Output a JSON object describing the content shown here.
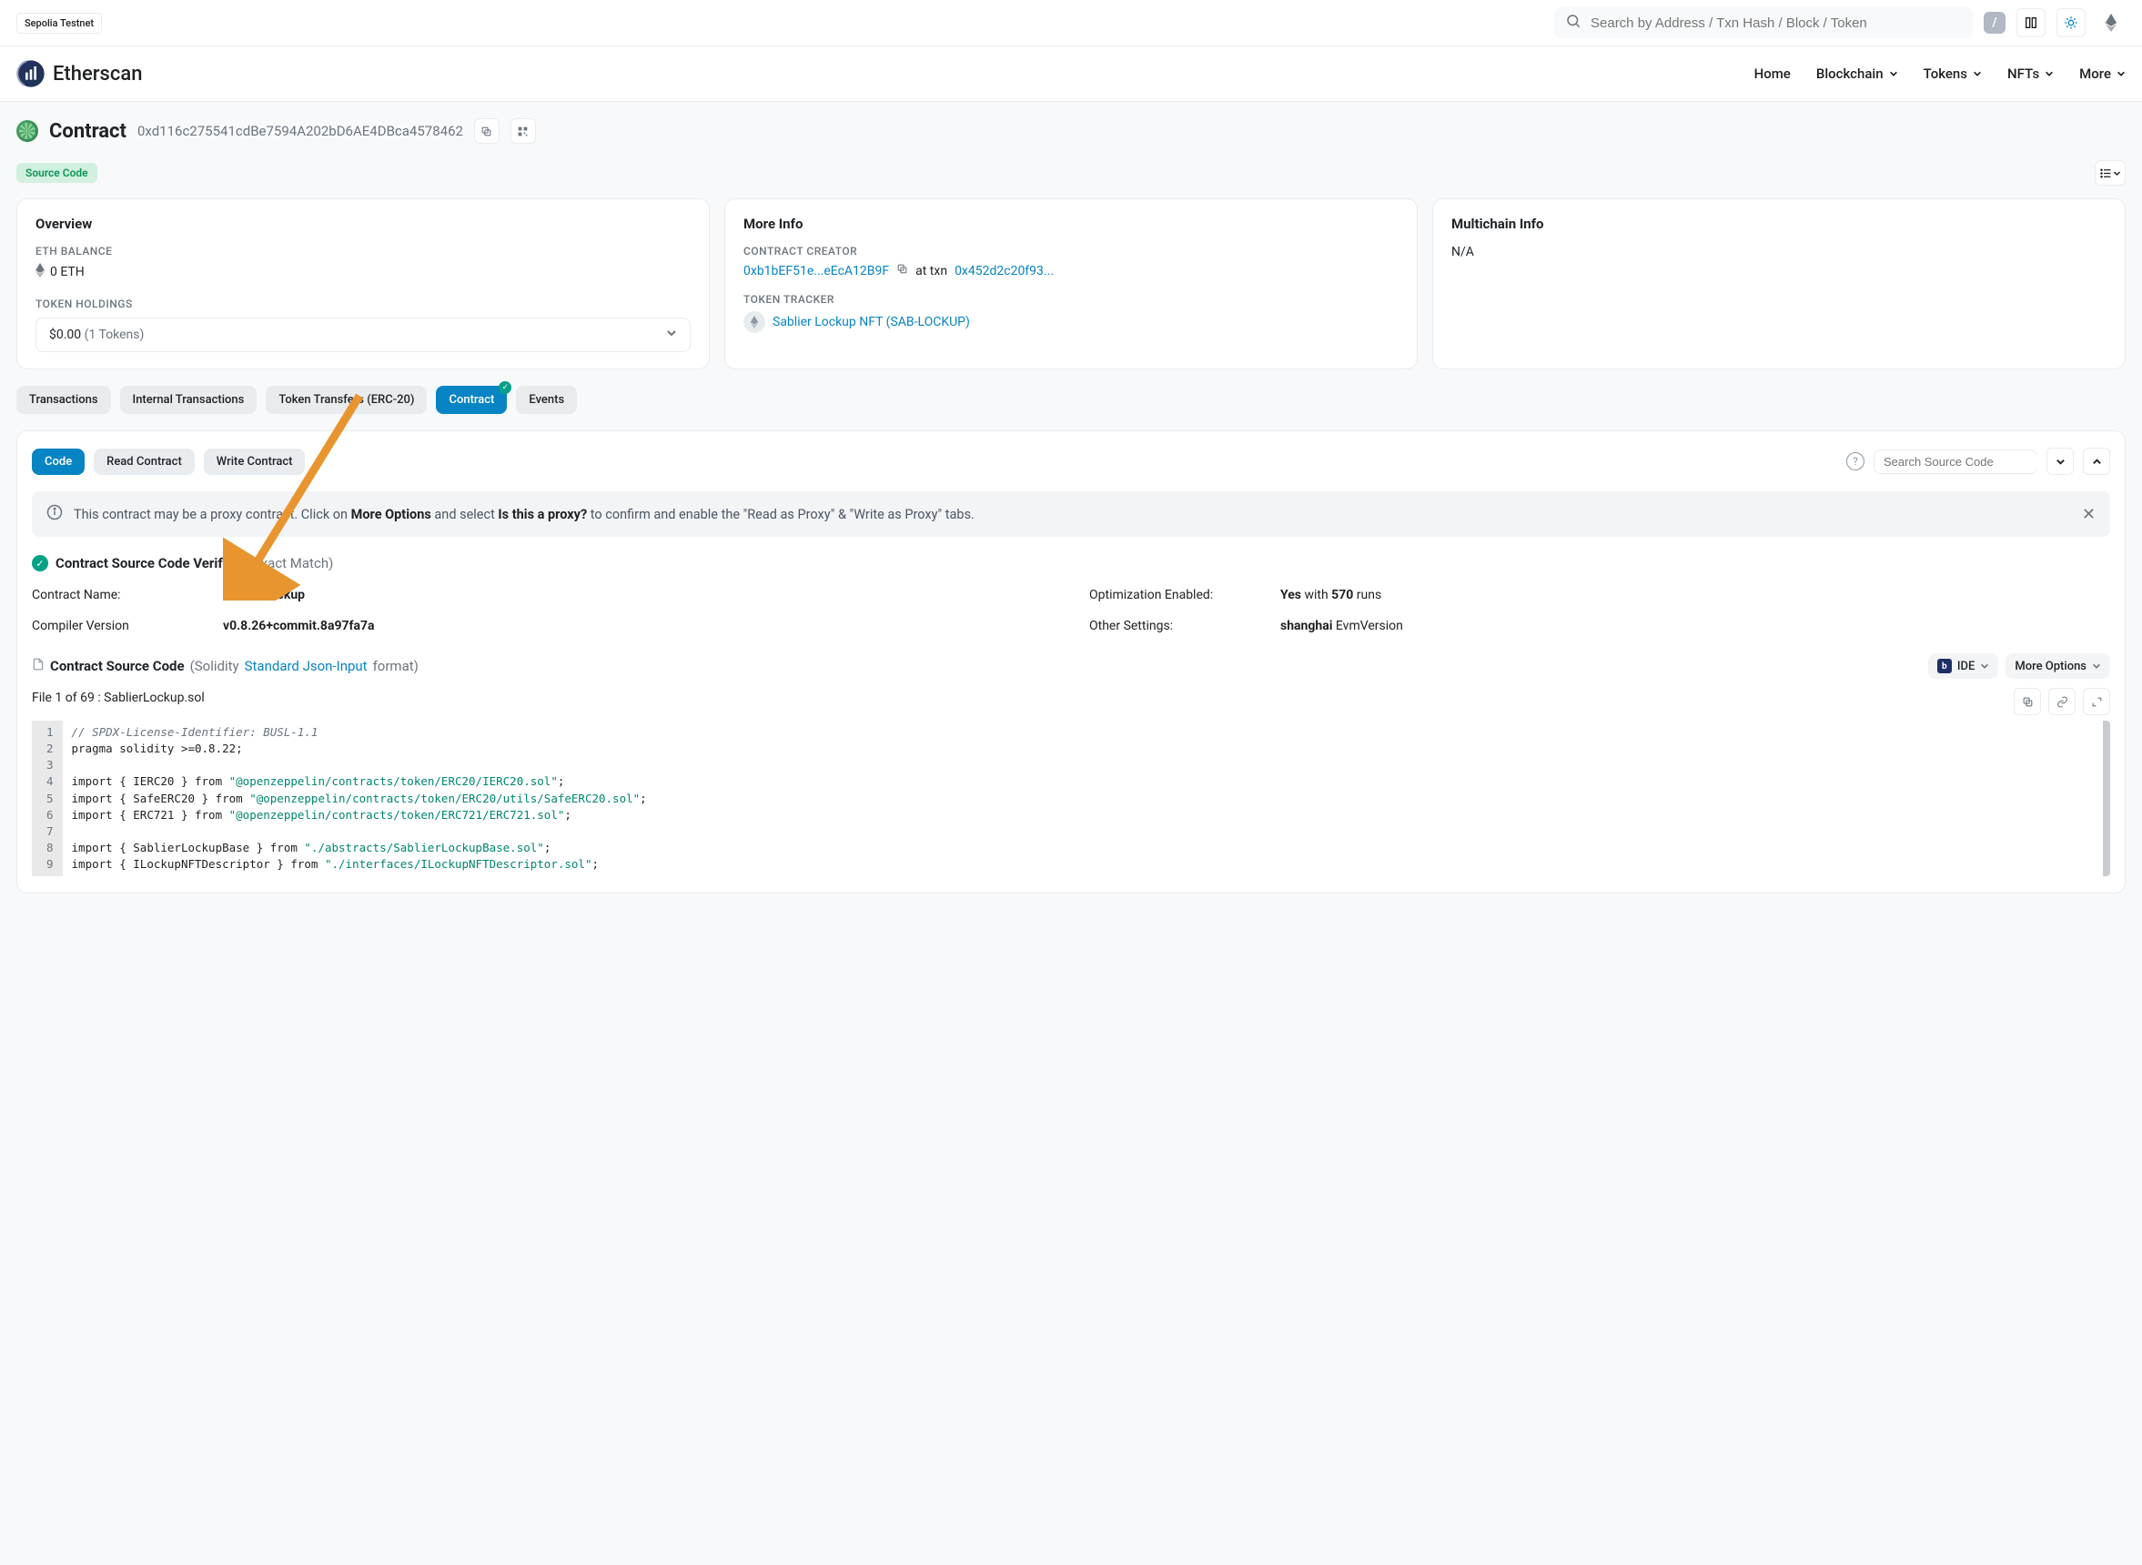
{
  "topbar": {
    "testnet": "Sepolia Testnet",
    "search_placeholder": "Search by Address / Txn Hash / Block / Token",
    "kbd": "/"
  },
  "header": {
    "brand": "Etherscan",
    "nav": {
      "home": "Home",
      "blockchain": "Blockchain",
      "tokens": "Tokens",
      "nfts": "NFTs",
      "more": "More"
    }
  },
  "title": {
    "label": "Contract",
    "address": "0xd116c275541cdBe7594A202bD6AE4DBca4578462"
  },
  "badges": {
    "src": "Source Code"
  },
  "cards": {
    "overview": {
      "heading": "Overview",
      "balance_label": "ETH BALANCE",
      "balance_value": "0 ETH",
      "holdings_label": "TOKEN HOLDINGS",
      "holdings_value": "$0.00",
      "holdings_count": "(1 Tokens)"
    },
    "moreinfo": {
      "heading": "More Info",
      "creator_label": "CONTRACT CREATOR",
      "creator_addr": "0xb1bEF51e...eEcA12B9F",
      "at_txn": "at txn",
      "creator_txn": "0x452d2c20f93...",
      "tracker_label": "TOKEN TRACKER",
      "tracker_name": "Sablier Lockup NFT (SAB-LOCKUP)"
    },
    "multichain": {
      "heading": "Multichain Info",
      "value": "N/A"
    }
  },
  "tabs": {
    "transactions": "Transactions",
    "internal": "Internal Transactions",
    "transfers": "Token Transfers (ERC-20)",
    "contract": "Contract",
    "events": "Events"
  },
  "subtabs": {
    "code": "Code",
    "read": "Read Contract",
    "write": "Write Contract",
    "search_placeholder": "Search Source Code"
  },
  "notice": {
    "prefix": "This contract may be a proxy contract. Click on",
    "more_options": "More Options",
    "mid": "and select",
    "is_proxy": "Is this a proxy?",
    "suffix": "to confirm and enable the \"Read as Proxy\" & \"Write as Proxy\" tabs."
  },
  "verified": {
    "label": "Contract Source Code Verified",
    "match": "(Exact Match)"
  },
  "meta": {
    "contract_name_k": "Contract Name:",
    "contract_name_v": "SablierLockup",
    "compiler_k": "Compiler Version",
    "compiler_v": "v0.8.26+commit.8a97fa7a",
    "optimization_k": "Optimization Enabled:",
    "optimization_yes": "Yes",
    "optimization_with": "with",
    "optimization_runs": "570",
    "optimization_runs_label": "runs",
    "other_k": "Other Settings:",
    "other_v_b": "shanghai",
    "other_v_rest": "EvmVersion"
  },
  "source": {
    "title": "Contract Source Code",
    "lang_open": "(Solidity",
    "link": "Standard Json-Input",
    "lang_close": "format)",
    "ide": "IDE",
    "more_options": "More Options",
    "file_label": "File 1 of 69 : SablierLockup.sol",
    "code": {
      "l1_pre": "// SPDX-License-Identifier: BUSL-1.1",
      "l2_a": "pragma solidity >=",
      "l2_b": "0.8.22",
      "l2_c": ";",
      "l4_a": "import { IERC20 } from ",
      "l4_b": "\"@openzeppelin/contracts/token/ERC20/IERC20.sol\"",
      "l4_c": ";",
      "l5_a": "import { SafeERC20 } from ",
      "l5_b": "\"@openzeppelin/contracts/token/ERC20/utils/SafeERC20.sol\"",
      "l5_c": ";",
      "l6_a": "import { ERC721 } from ",
      "l6_b": "\"@openzeppelin/contracts/token/ERC721/ERC721.sol\"",
      "l6_c": ";",
      "l8_a": "import { SablierLockupBase } from ",
      "l8_b": "\"./abstracts/SablierLockupBase.sol\"",
      "l8_c": ";",
      "l9_a": "import { ILockupNFTDescriptor } from ",
      "l9_b": "\"./interfaces/ILockupNFTDescriptor.sol\"",
      "l9_c": ";"
    }
  }
}
